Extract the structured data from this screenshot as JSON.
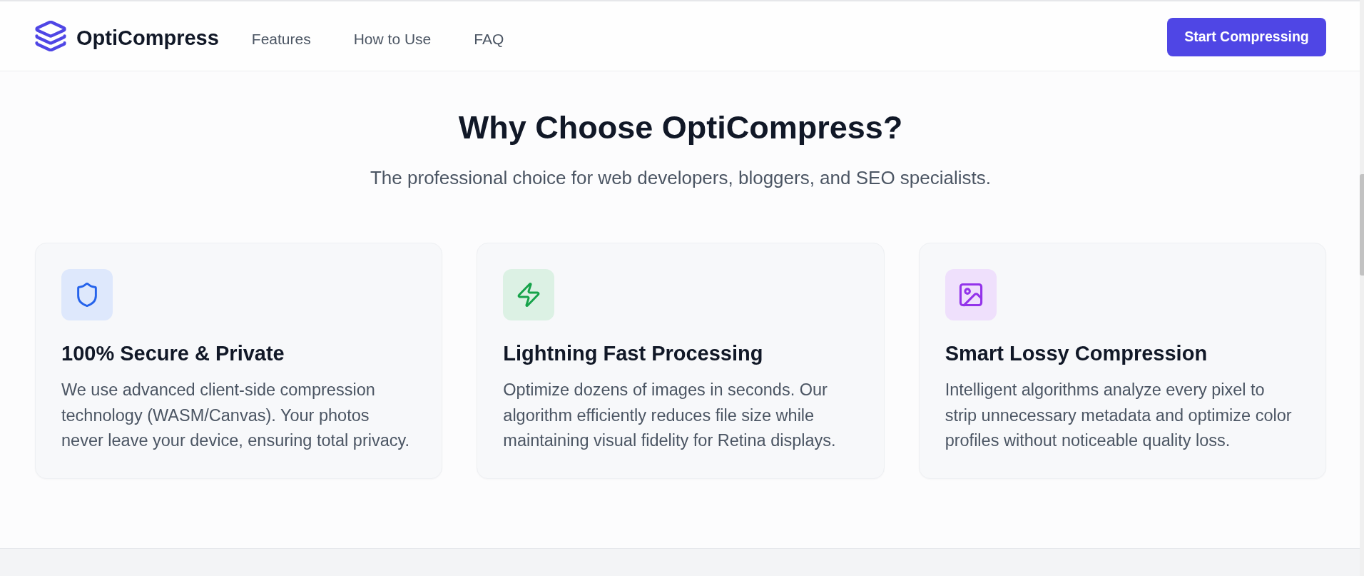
{
  "header": {
    "logo": {
      "text": "OptiCompress"
    },
    "nav": [
      {
        "label": "Features"
      },
      {
        "label": "How to Use"
      },
      {
        "label": "FAQ"
      }
    ],
    "cta_button": {
      "label": "Start Compressing"
    }
  },
  "section": {
    "title": "Why Choose OptiCompress?",
    "subtitle": "The professional choice for web developers, bloggers, and SEO specialists.",
    "features": [
      {
        "kind": "shield",
        "color": "#2563eb",
        "title": "100% Secure & Private",
        "description": "We use advanced client-side compression technology (WASM/Canvas). Your photos never leave your device, ensuring total privacy."
      },
      {
        "kind": "bolt",
        "color": "#16a34a",
        "title": "Lightning Fast Processing",
        "description": "Optimize dozens of images in seconds. Our algorithm efficiently reduces file size while maintaining visual fidelity for Retina displays."
      },
      {
        "kind": "image",
        "color": "#9333ea",
        "title": "Smart Lossy Compression",
        "description": "Intelligent algorithms analyze every pixel to strip unnecessary metadata and optimize color profiles without noticeable quality loss."
      }
    ]
  }
}
